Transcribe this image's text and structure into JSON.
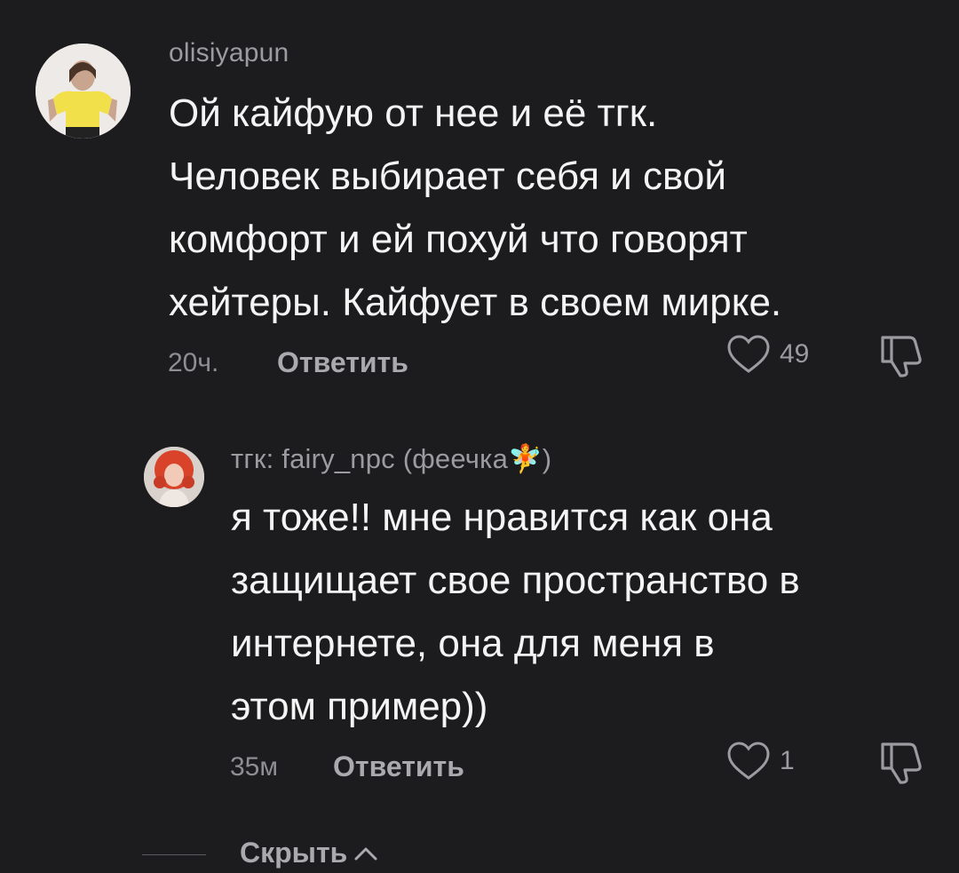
{
  "comment": {
    "username": "olisiyapun",
    "text": "Ой кайфую от нее и её тгк.\nЧеловек выбирает себя и свой\nкомфорт и ей похуй что говорят\nхейтеры. Кайфует в своем мирке.",
    "time": "20ч.",
    "reply_label": "Ответить",
    "like_count": "49",
    "reply": {
      "username": "тгк: fairy_npc (феечка🧚)",
      "text": "я тоже!! мне нравится как она\nзащищает свое пространство в\nинтернете, она для меня в\nэтом пример))",
      "time": "35м",
      "reply_label": "Ответить",
      "like_count": "1"
    }
  },
  "hide_label": "Скрыть",
  "icons": {
    "like": "heart-outline-icon",
    "dislike": "thumbs-down-icon",
    "collapse": "chevron-up-icon"
  },
  "colors": {
    "background": "#1c1c1e",
    "text": "#f4f4f4",
    "muted": "#9b9ba0"
  }
}
